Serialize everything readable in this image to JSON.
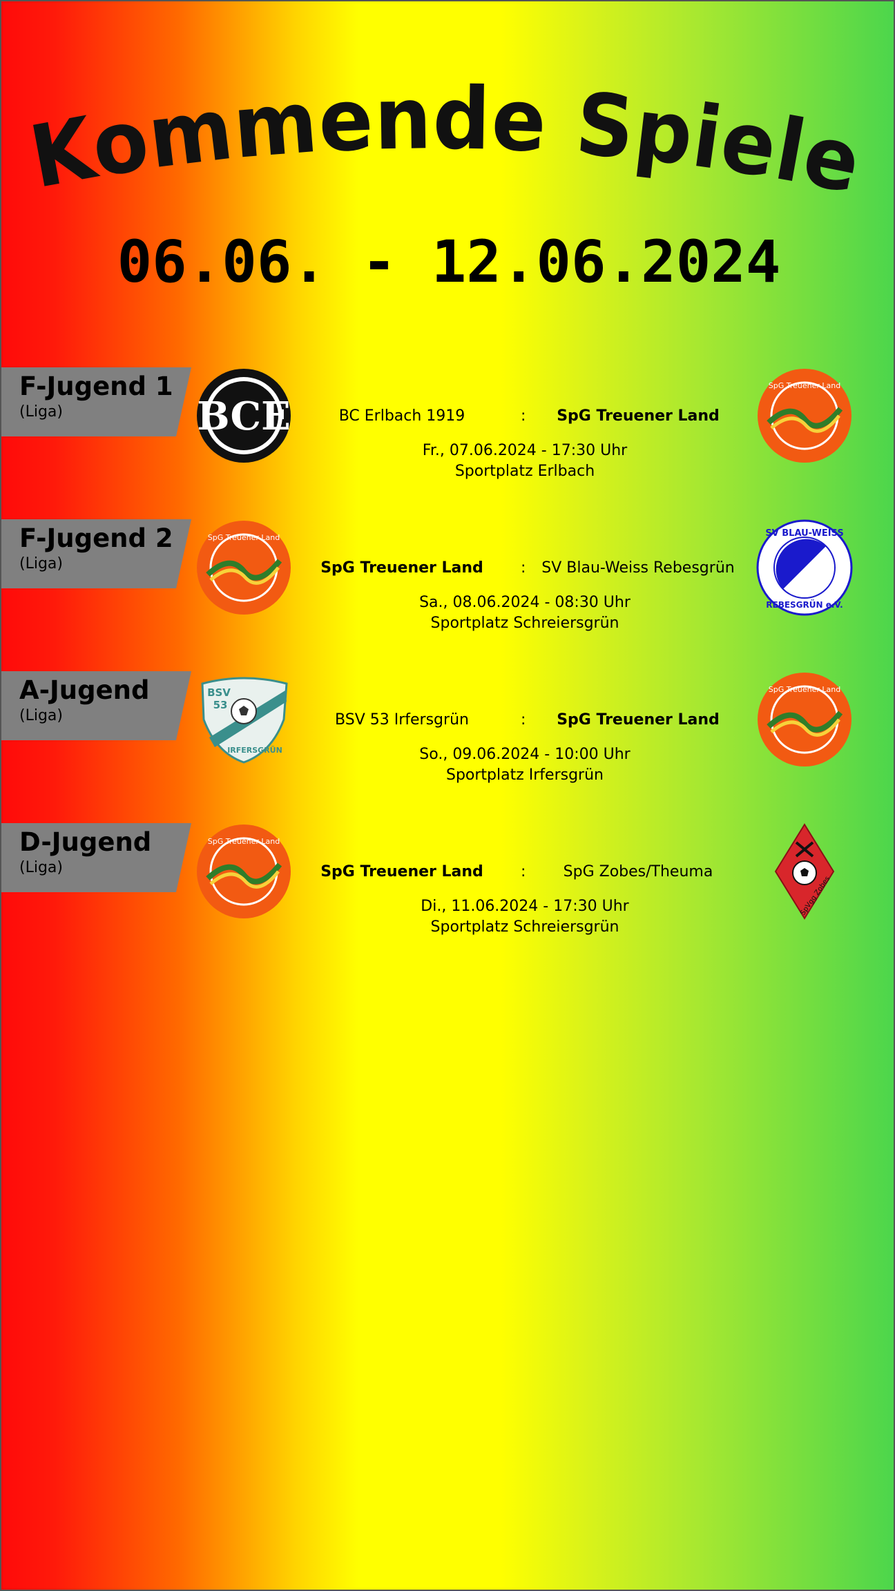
{
  "title": "Kommende Spiele",
  "date_range": "06.06. - 12.06.2024",
  "colors": {
    "tag_gray": "#808080",
    "club_orange": "#f25a12",
    "club_green": "#2f7d2a",
    "blue": "#1a1acc",
    "red": "#d8262b"
  },
  "matches": [
    {
      "team": "F-Jugend 1",
      "league": "(Liga)",
      "home": "BC Erlbach 1919",
      "separator": ":",
      "away": "SpG Treuener Land",
      "when": "Fr., 07.06.2024 - 17:30 Uhr",
      "where": "Sportplatz Erlbach",
      "home_logo": "bce-logo",
      "away_logo": "spg-treuener-land-logo",
      "home_logo_text": "BCE",
      "away_logo_text": "SpG Treuener Land"
    },
    {
      "team": "F-Jugend 2",
      "league": "(Liga)",
      "home": "SpG Treuener Land",
      "separator": ":",
      "away": "SV Blau-Weiss Rebesgrün",
      "when": "Sa., 08.06.2024 - 08:30 Uhr",
      "where": "Sportplatz Schreiersgrün",
      "home_logo": "spg-treuener-land-logo",
      "away_logo": "sv-blau-weiss-logo",
      "home_logo_text": "SpG Treuener Land",
      "away_logo_text_top": "SV BLAU-WEISS",
      "away_logo_text_bottom": "REBESGRÜN e.V."
    },
    {
      "team": "A-Jugend",
      "league": "(Liga)",
      "home": "BSV 53 Irfersgrün",
      "separator": ":",
      "away": "SpG Treuener Land",
      "when": "So., 09.06.2024 - 10:00 Uhr",
      "where": "Sportplatz Irfersgrün",
      "home_logo": "bsv-53-logo",
      "away_logo": "spg-treuener-land-logo",
      "home_logo_text_top": "BSV",
      "home_logo_text_num": "53",
      "home_logo_text_bottom": "IRFERSGRÜN",
      "away_logo_text": "SpG Treuener Land"
    },
    {
      "team": "D-Jugend",
      "league": "(Liga)",
      "home": "SpG Treuener Land",
      "separator": ":",
      "away": "SpG Zobes/Theuma",
      "when": "Di., 11.06.2024 - 17:30 Uhr",
      "where": "Sportplatz Schreiersgrün",
      "home_logo": "spg-treuener-land-logo",
      "away_logo": "spvgg-zobes-logo",
      "home_logo_text": "SpG Treuener Land",
      "away_logo_text": "SpVgg Zobes"
    }
  ]
}
